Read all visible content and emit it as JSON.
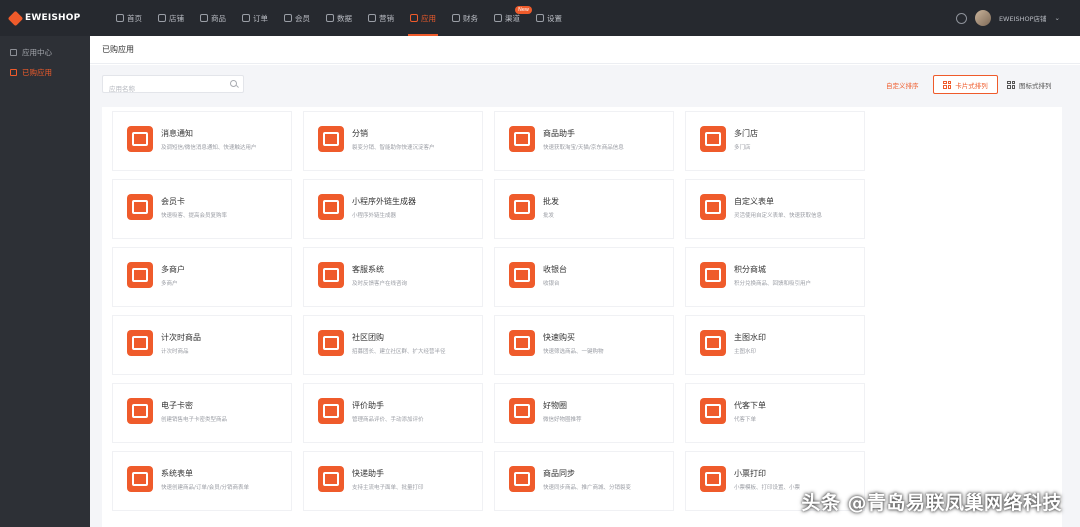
{
  "brand": {
    "name": "EWEISHOP"
  },
  "nav": [
    {
      "id": "home",
      "label": "首页",
      "icon": "home-icon"
    },
    {
      "id": "store",
      "label": "店铺",
      "icon": "store-icon"
    },
    {
      "id": "goods",
      "label": "商品",
      "icon": "goods-icon"
    },
    {
      "id": "orders",
      "label": "订单",
      "icon": "orders-icon"
    },
    {
      "id": "members",
      "label": "会员",
      "icon": "user-icon"
    },
    {
      "id": "data",
      "label": "数据",
      "icon": "chart-icon"
    },
    {
      "id": "marketing",
      "label": "营销",
      "icon": "tag-icon"
    },
    {
      "id": "apps",
      "label": "应用",
      "icon": "calendar-icon",
      "active": true
    },
    {
      "id": "finance",
      "label": "财务",
      "icon": "wallet-icon"
    },
    {
      "id": "channels",
      "label": "渠道",
      "icon": "channel-icon",
      "badge": "New"
    },
    {
      "id": "settings",
      "label": "设置",
      "icon": "gear-icon"
    }
  ],
  "user": {
    "name": "EWEISHOP店铺"
  },
  "sidebar": [
    {
      "label": "应用中心",
      "active": false
    },
    {
      "label": "已购应用",
      "active": true
    }
  ],
  "page": {
    "title": "已购应用"
  },
  "toolbar": {
    "search_placeholder": "应用名称",
    "sort_label": "自定义排序",
    "card_view_label": "卡片式排列",
    "list_view_label": "图标式排列"
  },
  "apps": [
    {
      "title": "消息通知",
      "desc": "及调短信/微信消息通知、快速触达用户"
    },
    {
      "title": "分销",
      "desc": "裂变分销、智能助你快速沉淀客户"
    },
    {
      "title": "商品助手",
      "desc": "快速获取淘宝/天猫/京东商品信息"
    },
    {
      "title": "多门店",
      "desc": "多门店"
    },
    {
      "title": "会员卡",
      "desc": "快速吸客、提高会员复购率"
    },
    {
      "title": "小程序外链生成器",
      "desc": "小程序外链生成器"
    },
    {
      "title": "批发",
      "desc": "批发"
    },
    {
      "title": "自定义表单",
      "desc": "灵活使用自定义表单、快速获取信息"
    },
    {
      "title": "多商户",
      "desc": "多商户"
    },
    {
      "title": "客服系统",
      "desc": "及时反馈客户在线咨询"
    },
    {
      "title": "收银台",
      "desc": "收银台"
    },
    {
      "title": "积分商城",
      "desc": "积分兑换商品、回馈和吸引用户"
    },
    {
      "title": "计次时商品",
      "desc": "计次时商品"
    },
    {
      "title": "社区团购",
      "desc": "招募团长、建立社区群、扩大经营半径"
    },
    {
      "title": "快速购买",
      "desc": "快速筛选商品、一键购物"
    },
    {
      "title": "主图水印",
      "desc": "主图水印"
    },
    {
      "title": "电子卡密",
      "desc": "创建销售电子卡密类型商品"
    },
    {
      "title": "评价助手",
      "desc": "管理商品评价、手动添加评价"
    },
    {
      "title": "好物圈",
      "desc": "微信好物圈推荐"
    },
    {
      "title": "代客下单",
      "desc": "代客下单"
    },
    {
      "title": "系统表单",
      "desc": "快速创建商品/订单/会员/分销商表单"
    },
    {
      "title": "快递助手",
      "desc": "支持主流电子面单、批量打印"
    },
    {
      "title": "商品同步",
      "desc": "快速同步商品、推广商城、分销裂变"
    },
    {
      "title": "小票打印",
      "desc": "小票模板、打印设置、小票"
    }
  ],
  "watermark": "头条 @青岛易联凤巢网络科技",
  "colors": {
    "accent": "#ef5b2b",
    "topbar": "#26292f",
    "sidebar": "#2d3036"
  }
}
